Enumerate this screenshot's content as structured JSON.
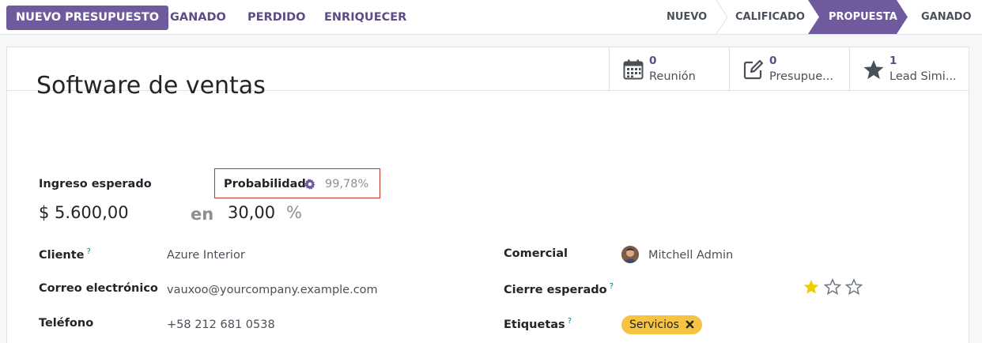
{
  "control_panel": {
    "new_quotation": "NUEVO PRESUPUESTO",
    "won": "GANADO",
    "lost": "PERDIDO",
    "enrich": "ENRIQUECER"
  },
  "stages": [
    {
      "label": "NUEVO",
      "active": false
    },
    {
      "label": "CALIFICADO",
      "active": false
    },
    {
      "label": "PROPUESTA",
      "active": true
    },
    {
      "label": "GANADO",
      "active": false
    }
  ],
  "smart_buttons": [
    {
      "count": "0",
      "label": "Reunión",
      "icon": "calendar-icon"
    },
    {
      "count": "0",
      "label": "Presupue...",
      "icon": "edit-icon"
    },
    {
      "count": "1",
      "label": "Lead Simi...",
      "icon": "star-icon"
    }
  ],
  "record": {
    "name": "Software de ventas",
    "expected_revenue_label": "Ingreso esperado",
    "expected_revenue": "$ 5.600,00",
    "at_word": "en",
    "probability_label": "Probabilidad",
    "automated_probability": "99,78%",
    "probability": "30,00",
    "percent": "%"
  },
  "fields_left": {
    "customer_label": "Cliente",
    "customer": "Azure Interior",
    "email_label": "Correo electrónico",
    "email": "vauxoo@yourcompany.example.com",
    "phone_label": "Teléfono",
    "phone": "+58 212 681 0538"
  },
  "fields_right": {
    "salesperson_label": "Comercial",
    "salesperson": "Mitchell Admin",
    "deadline_label": "Cierre esperado",
    "priority_stars": 1,
    "priority_max": 3,
    "tags_label": "Etiquetas",
    "tag": "Servicios"
  },
  "help_marker": "?",
  "colors": {
    "primary": "#6f5a9e",
    "link": "#5d4b87",
    "star": "#f3cc00",
    "tag": "#f6c342",
    "highlight": "#c0392b"
  }
}
